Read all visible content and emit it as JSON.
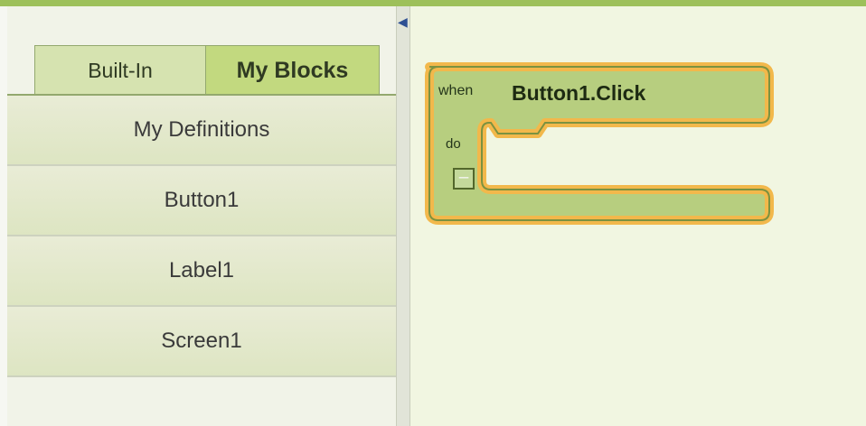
{
  "palette": {
    "accent": "#9dc05a",
    "block_fill": "#b7ce7f",
    "block_highlight": "#f2b84b",
    "workspace_bg": "#f1f6e1"
  },
  "tabs": [
    {
      "label": "Built-In",
      "selected": false
    },
    {
      "label": "My Blocks",
      "selected": true
    }
  ],
  "drawers": [
    {
      "label": "My Definitions"
    },
    {
      "label": "Button1"
    },
    {
      "label": "Label1"
    },
    {
      "label": "Screen1"
    }
  ],
  "block": {
    "when_label": "when",
    "event_name": "Button1.Click",
    "do_label": "do",
    "collapse_symbol": "–"
  },
  "icons": {
    "collapse_arrow": "caret-left-icon"
  }
}
